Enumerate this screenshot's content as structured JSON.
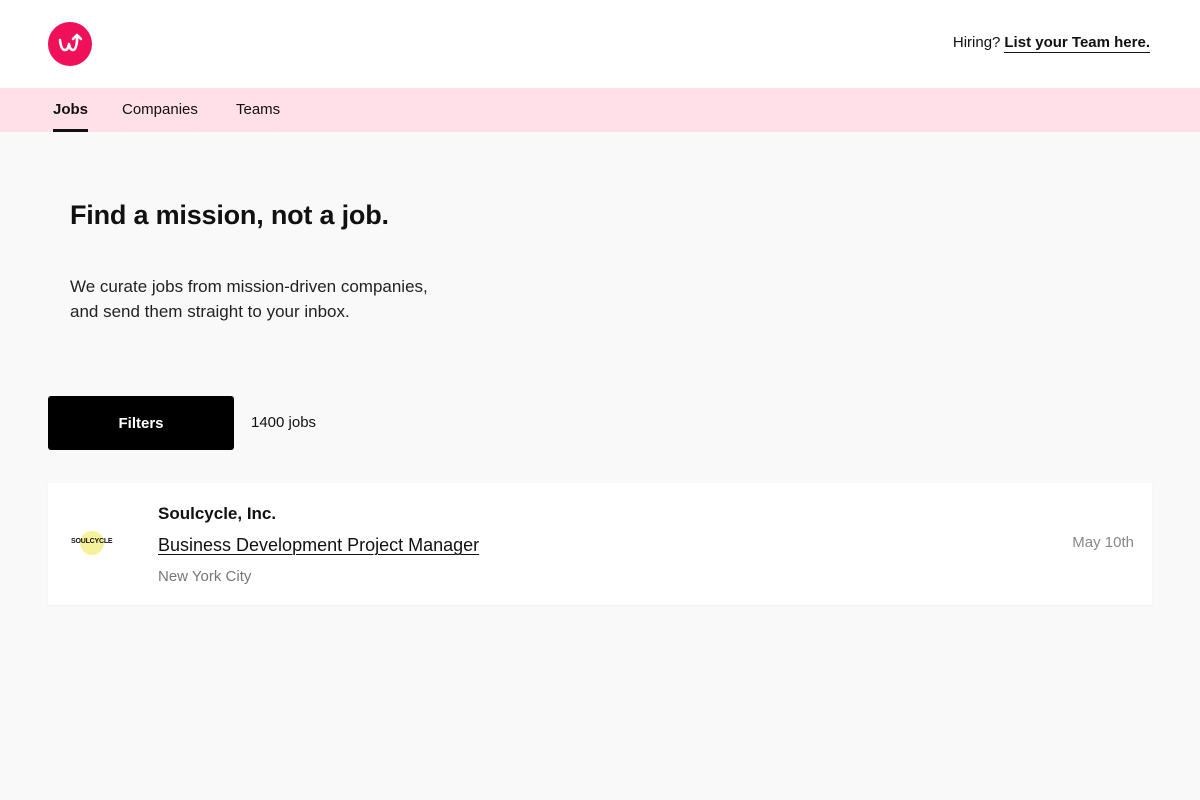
{
  "header": {
    "logo_icon": "wellfound-arrow-logo-icon",
    "brand_color": "#f0105a",
    "hiring_prefix": "Hiring?",
    "hiring_link": "List your Team here."
  },
  "nav": {
    "background": "#ffe0e8",
    "tabs": [
      {
        "label": "Jobs",
        "active": true
      },
      {
        "label": "Companies",
        "active": false
      },
      {
        "label": "Teams",
        "active": false
      }
    ]
  },
  "hero": {
    "title": "Find a mission, not a job.",
    "subtitle_line1": "We curate jobs from mission-driven companies,",
    "subtitle_line2": "and send them straight to your inbox."
  },
  "toolbar": {
    "filters_label": "Filters",
    "job_count": "1400 jobs"
  },
  "jobs": [
    {
      "company": "Soulcycle, Inc.",
      "logo_text": "SOULCYCLE",
      "title": "Business Development Project Manager",
      "location": "New York City",
      "date": "May 10th"
    }
  ]
}
